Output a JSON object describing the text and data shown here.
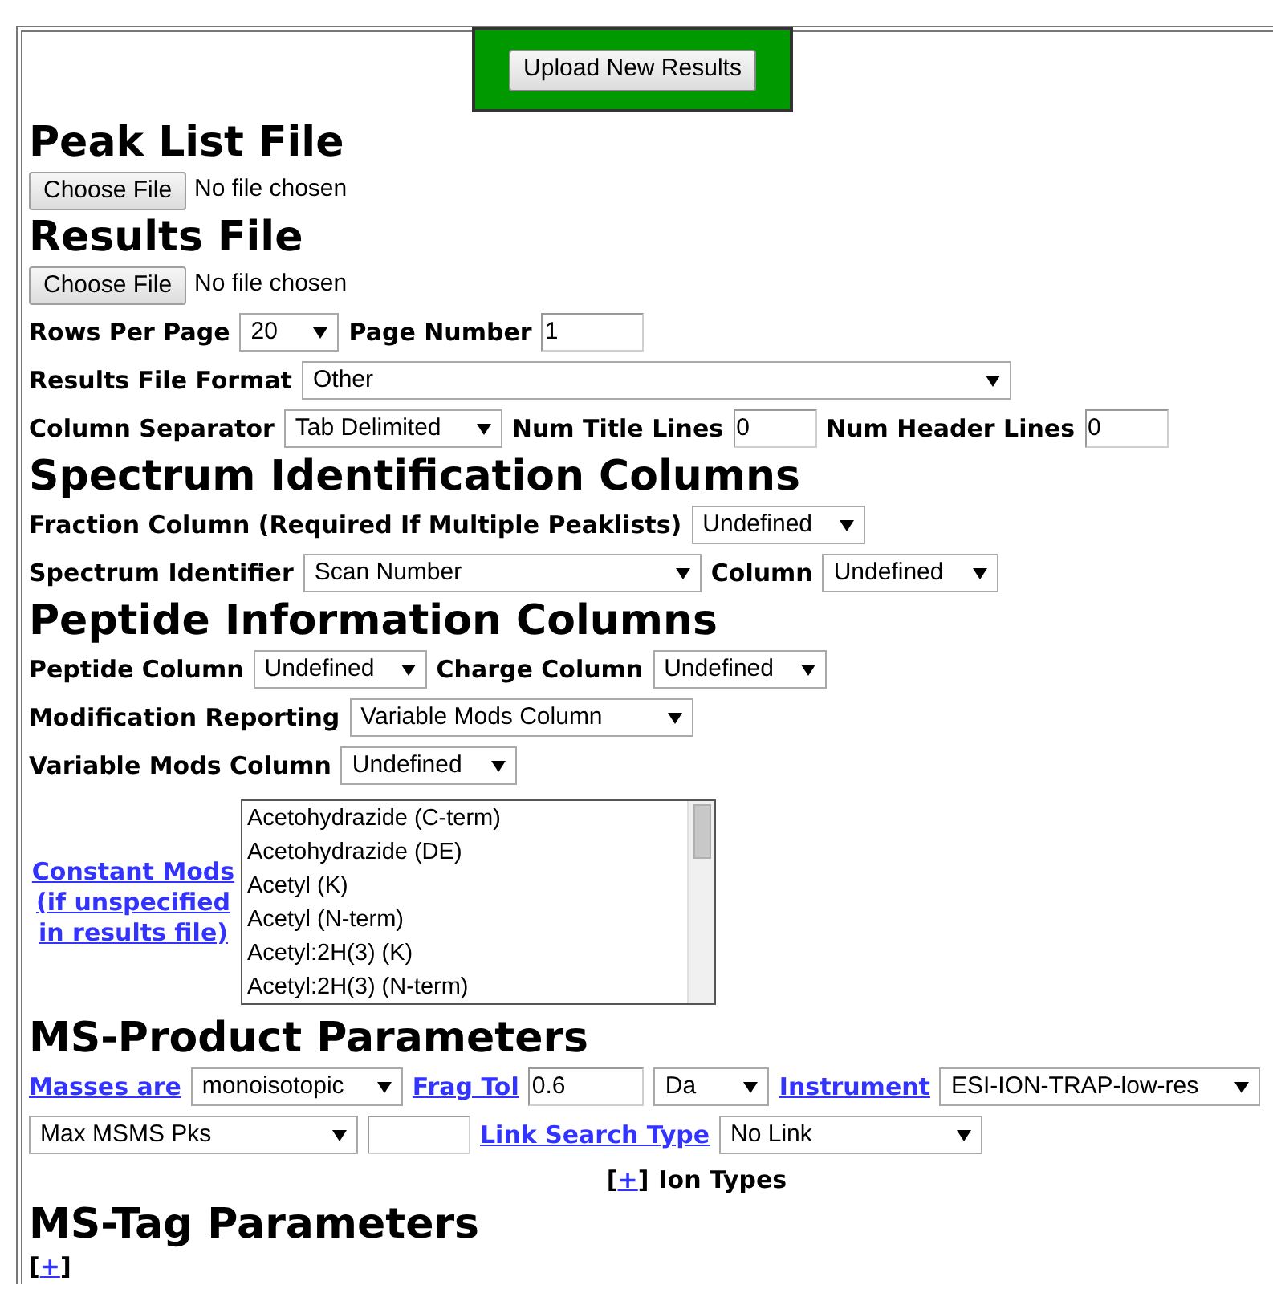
{
  "upload_button": "Upload New Results",
  "blocks": [
    {
      "kind": "heading",
      "text": "Peak List File"
    },
    {
      "kind": "file",
      "button": "Choose File",
      "status": "No file chosen"
    },
    {
      "kind": "heading",
      "text": "Results File"
    },
    {
      "kind": "file",
      "button": "Choose File",
      "status": "No file chosen"
    },
    {
      "kind": "row",
      "items": [
        {
          "kind": "label",
          "text": "Rows Per Page"
        },
        {
          "kind": "select",
          "value": "20"
        },
        {
          "kind": "label",
          "text": "Page Number"
        },
        {
          "kind": "input",
          "value": "1"
        }
      ]
    },
    {
      "kind": "row",
      "items": [
        {
          "kind": "label",
          "text": "Results File Format"
        },
        {
          "kind": "select",
          "value": "Other"
        }
      ]
    },
    {
      "kind": "row",
      "items": [
        {
          "kind": "label",
          "text": "Column Separator"
        },
        {
          "kind": "select",
          "value": "Tab Delimited"
        },
        {
          "kind": "label",
          "text": "Num Title Lines"
        },
        {
          "kind": "input",
          "value": "0"
        },
        {
          "kind": "label",
          "text": "Num Header Lines"
        },
        {
          "kind": "input",
          "value": "0"
        }
      ]
    },
    {
      "kind": "heading",
      "text": "Spectrum Identification Columns"
    },
    {
      "kind": "row",
      "items": [
        {
          "kind": "label",
          "text": "Fraction Column (Required If Multiple Peaklists)"
        },
        {
          "kind": "select",
          "value": "Undefined"
        }
      ]
    },
    {
      "kind": "row",
      "items": [
        {
          "kind": "label",
          "text": "Spectrum Identifier"
        },
        {
          "kind": "select",
          "value": "Scan Number"
        },
        {
          "kind": "label",
          "text": "Column"
        },
        {
          "kind": "select",
          "value": "Undefined"
        }
      ]
    },
    {
      "kind": "heading",
      "text": "Peptide Information Columns"
    },
    {
      "kind": "row",
      "items": [
        {
          "kind": "label",
          "text": "Peptide Column"
        },
        {
          "kind": "select",
          "value": "Undefined"
        },
        {
          "kind": "label",
          "text": "Charge Column"
        },
        {
          "kind": "select",
          "value": "Undefined"
        }
      ]
    },
    {
      "kind": "row",
      "items": [
        {
          "kind": "label",
          "text": "Modification Reporting"
        },
        {
          "kind": "select",
          "value": "Variable Mods Column"
        }
      ]
    },
    {
      "kind": "row",
      "items": [
        {
          "kind": "label",
          "text": "Variable Mods Column"
        },
        {
          "kind": "select",
          "value": "Undefined"
        }
      ]
    },
    {
      "kind": "mods",
      "link": "Constant Mods (if unspecified in results file)",
      "options": [
        "Acetohydrazide (C-term)",
        "Acetohydrazide (DE)",
        "Acetyl (K)",
        "Acetyl (N-term)",
        "Acetyl:2H(3) (K)",
        "Acetyl:2H(3) (N-term)"
      ]
    },
    {
      "kind": "heading",
      "text": "MS-Product Parameters"
    },
    {
      "kind": "row",
      "items": [
        {
          "kind": "link",
          "text": "Masses are"
        },
        {
          "kind": "select",
          "value": "monoisotopic"
        },
        {
          "kind": "link",
          "text": "Frag Tol"
        },
        {
          "kind": "input",
          "value": "0.6"
        },
        {
          "kind": "select",
          "value": "Da"
        },
        {
          "kind": "link",
          "text": "Instrument"
        },
        {
          "kind": "select",
          "value": "ESI-ION-TRAP-low-res"
        }
      ]
    },
    {
      "kind": "row",
      "items": [
        {
          "kind": "select",
          "value": "Max MSMS Pks"
        },
        {
          "kind": "input",
          "value": ""
        },
        {
          "kind": "link",
          "text": "Link Search Type"
        },
        {
          "kind": "select",
          "value": "No Link"
        }
      ]
    },
    {
      "kind": "toggle",
      "centered": true,
      "open": "[",
      "link": "+",
      "close": "]",
      "label": "Ion Types"
    },
    {
      "kind": "heading",
      "text": "MS-Tag Parameters"
    },
    {
      "kind": "toggle",
      "centered": false,
      "open": "[",
      "link": "+",
      "close": "]"
    }
  ]
}
